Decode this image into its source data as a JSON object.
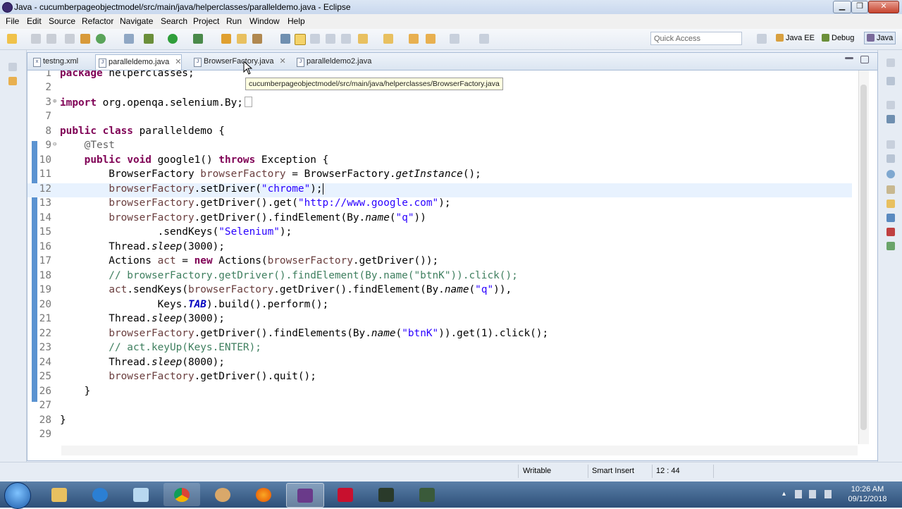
{
  "window": {
    "title": "Java - cucumberpageobjectmodel/src/main/java/helperclasses/paralleldemo.java - Eclipse",
    "btn_min": "▁",
    "btn_max": "❐",
    "btn_close": "✕"
  },
  "menu": [
    "File",
    "Edit",
    "Source",
    "Refactor",
    "Navigate",
    "Search",
    "Project",
    "Run",
    "Window",
    "Help"
  ],
  "toolbar": {
    "quick_access_placeholder": "Quick Access",
    "perspectives": [
      "Java EE",
      "Debug",
      "Java"
    ]
  },
  "tabs": [
    {
      "label": "testng.xml",
      "icon": "xml-file-icon"
    },
    {
      "label": "paralleldemo.java",
      "icon": "java-file-icon",
      "close": "✕"
    },
    {
      "label": "BrowserFactory.java",
      "icon": "java-file-icon",
      "close": "✕"
    },
    {
      "label": "paralleldemo2.java",
      "icon": "java-file-icon"
    }
  ],
  "tooltip": "cucumberpageobjectmodel/src/main/java/helperclasses/BrowserFactory.java",
  "code": {
    "active_line": 12,
    "lines": [
      {
        "n": "1",
        "t": "package helperclasses;"
      },
      {
        "n": "2",
        "t": ""
      },
      {
        "n": "3",
        "t": "import org.openqa.selenium.By;"
      },
      {
        "n": "7",
        "t": ""
      },
      {
        "n": "8",
        "t": "public class paralleldemo {"
      },
      {
        "n": "9",
        "t": "@Test"
      },
      {
        "n": "10",
        "t": "public void google1() throws Exception {"
      },
      {
        "n": "11",
        "t": "BrowserFactory browserFactory = BrowserFactory.getInstance();"
      },
      {
        "n": "12",
        "t": "browserFactory.setDriver(\"chrome\");"
      },
      {
        "n": "13",
        "t": "browserFactory.getDriver().get(\"http://www.google.com\");"
      },
      {
        "n": "14",
        "t": "browserFactory.getDriver().findElement(By.name(\"q\"))"
      },
      {
        "n": "15",
        "t": ".sendKeys(\"Selenium\");"
      },
      {
        "n": "16",
        "t": "Thread.sleep(3000);"
      },
      {
        "n": "17",
        "t": "Actions act = new Actions(browserFactory.getDriver());"
      },
      {
        "n": "18",
        "t": "// browserFactory.getDriver().findElement(By.name(\"btnK\")).click();"
      },
      {
        "n": "19",
        "t": "act.sendKeys(browserFactory.getDriver().findElement(By.name(\"q\")),"
      },
      {
        "n": "20",
        "t": "Keys.TAB).build().perform();"
      },
      {
        "n": "21",
        "t": "Thread.sleep(3000);"
      },
      {
        "n": "22",
        "t": "browserFactory.getDriver().findElements(By.name(\"btnK\")).get(1).click();"
      },
      {
        "n": "23",
        "t": "// act.keyUp(Keys.ENTER);"
      },
      {
        "n": "24",
        "t": "Thread.sleep(8000);"
      },
      {
        "n": "25",
        "t": "browserFactory.getDriver().quit();"
      },
      {
        "n": "26",
        "t": "}"
      },
      {
        "n": "27",
        "t": ""
      },
      {
        "n": "28",
        "t": "}"
      },
      {
        "n": "29",
        "t": ""
      }
    ]
  },
  "status": {
    "writable": "Writable",
    "insert_mode": "Smart Insert",
    "position": "12 : 44"
  },
  "clock": {
    "time": "10:26 AM",
    "date": "09/12/2018"
  }
}
